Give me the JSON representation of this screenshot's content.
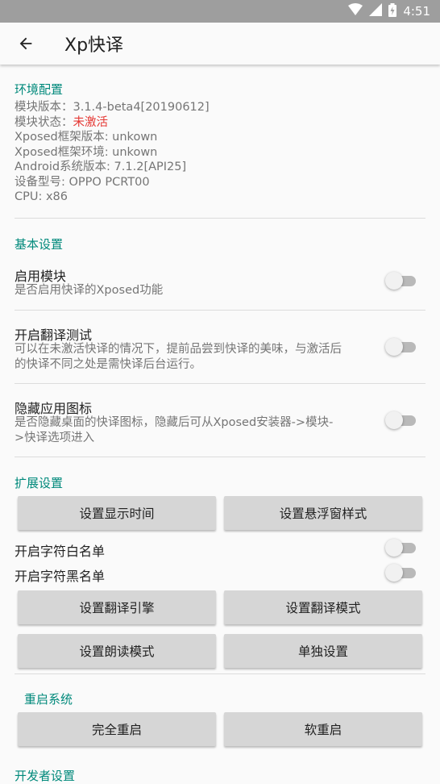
{
  "status_bar": {
    "time": "4:51",
    "icons": [
      "wifi-icon",
      "signal-icon",
      "battery-icon"
    ]
  },
  "app_bar": {
    "title": "Xp快译",
    "back_icon": "arrow-back-icon"
  },
  "env": {
    "title": "环境配置",
    "module_version_label": "模块版本：",
    "module_version": "3.1.4-beta4[20190612]",
    "module_status_label": "模块状态：",
    "module_status": "未激活",
    "xposed_version": "Xposed框架版本: unkown",
    "xposed_env": "Xposed框架环境: unkown",
    "android_version": "Android系统版本: 7.1.2[API25]",
    "device_model": "设备型号: OPPO PCRT00",
    "cpu": "CPU: x86"
  },
  "basic": {
    "title": "基本设置",
    "enable_module": {
      "title": "启用模块",
      "summary": "是否启用快译的Xposed功能",
      "checked": false
    },
    "translate_test": {
      "title": "开启翻译测试",
      "summary": "可以在未激活快译的情况下，提前品尝到快译的美味，与激活后的快译不同之处是需快译后台运行。",
      "checked": false
    },
    "hide_icon": {
      "title": "隐藏应用图标",
      "summary": "是否隐藏桌面的快译图标，隐藏后可从Xposed安装器->模块->快译选项进入",
      "checked": false
    }
  },
  "extended": {
    "title": "扩展设置",
    "btn_display_time": "设置显示时间",
    "btn_float_style": "设置悬浮窗样式",
    "whitelist": {
      "label": "开启字符白名单",
      "checked": false
    },
    "blacklist": {
      "label": "开启字符黑名单",
      "checked": false
    },
    "btn_engine": "设置翻译引擎",
    "btn_mode": "设置翻译模式",
    "btn_read_mode": "设置朗读模式",
    "btn_single": "单独设置"
  },
  "reboot": {
    "title": "重启系统",
    "btn_full": "完全重启",
    "btn_soft": "软重启"
  },
  "developer": {
    "title": "开发者设置"
  },
  "colors": {
    "accent": "#00897b",
    "warning": "#e53935",
    "button": "#d6d6d6"
  }
}
